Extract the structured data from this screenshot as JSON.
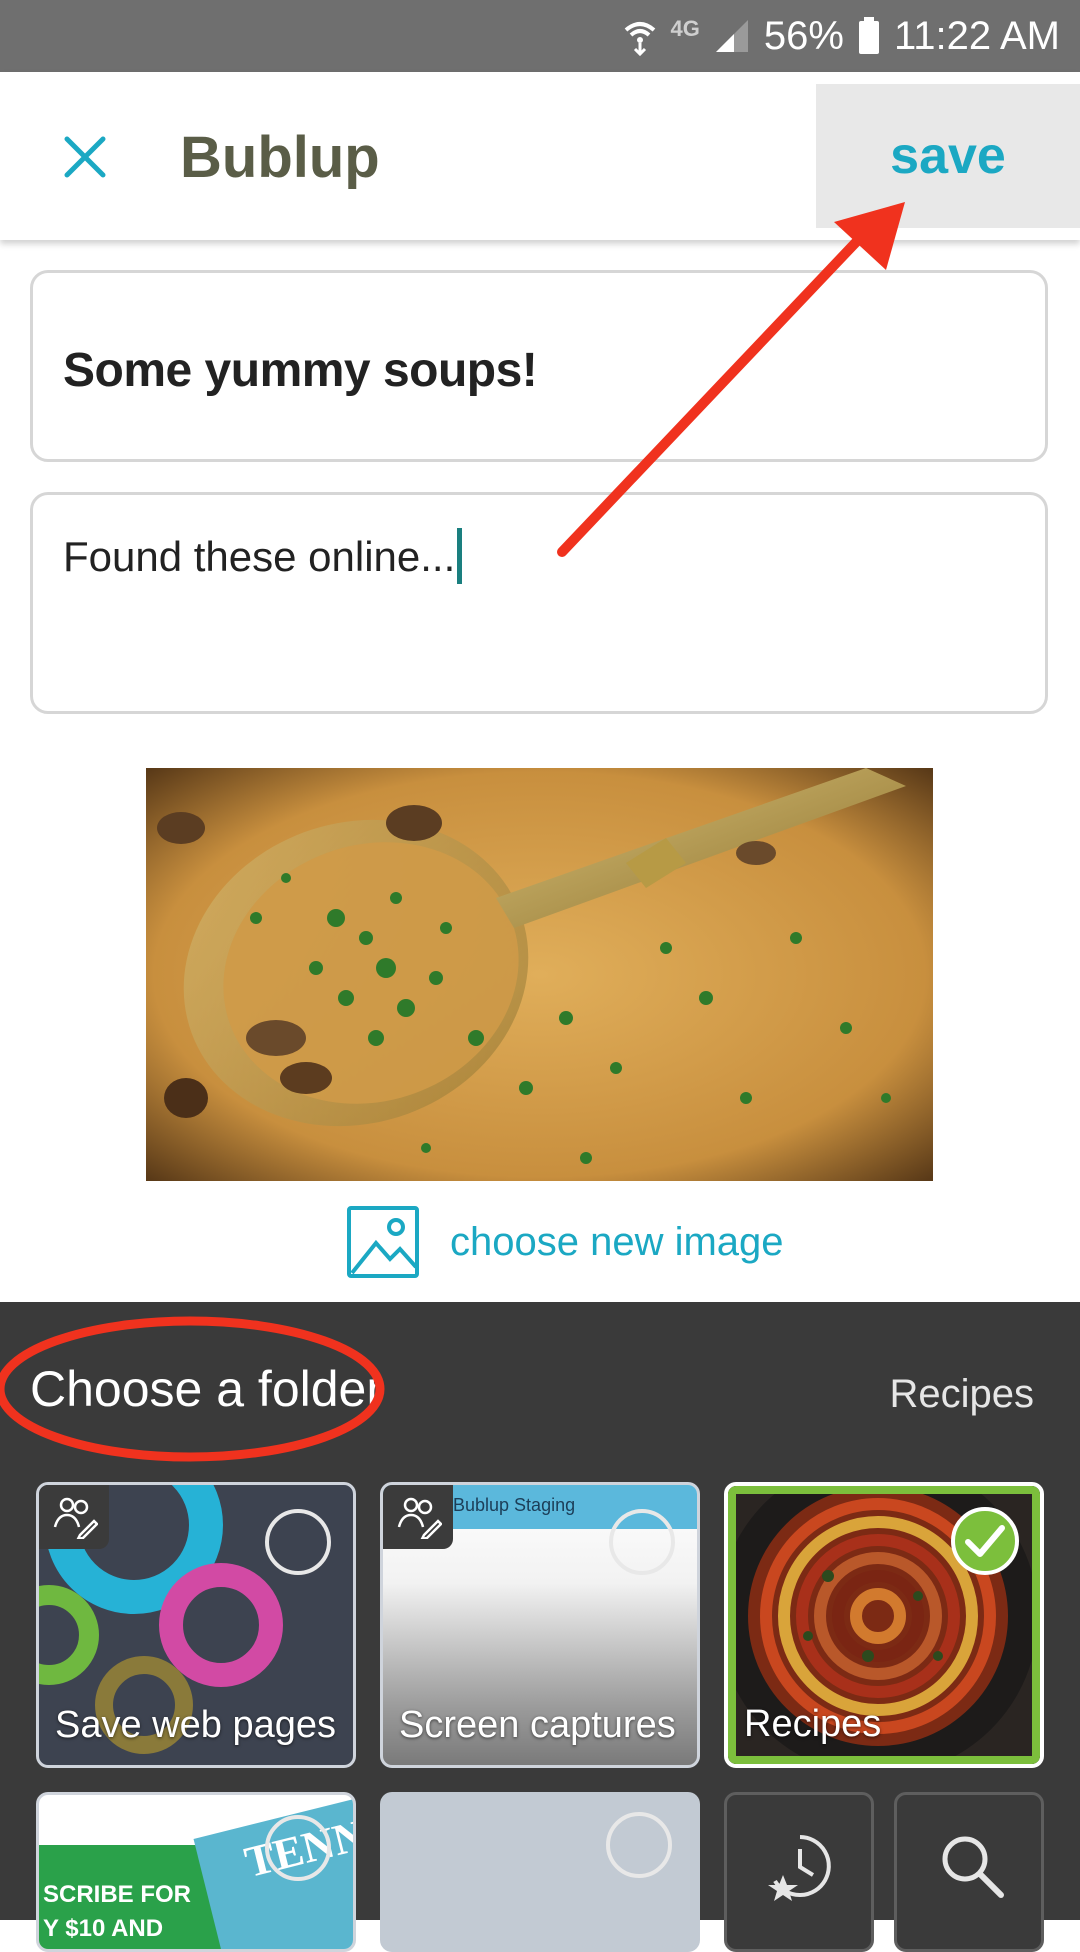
{
  "status_bar": {
    "network": "4G",
    "battery": "56%",
    "time": "11:22 AM"
  },
  "header": {
    "app_title": "Bublup",
    "save_label": "save"
  },
  "form": {
    "title_value": "Some yummy soups!",
    "description_value": "Found these online..."
  },
  "image": {
    "choose_label": "choose new image"
  },
  "folders": {
    "heading": "Choose a folder",
    "selected": "Recipes",
    "items": [
      {
        "label": "Save web pages",
        "shared": true,
        "selected": false
      },
      {
        "label": "Screen captures",
        "shared": true,
        "selected": false,
        "preview_text": "Bublup Staging"
      },
      {
        "label": "Recipes",
        "shared": false,
        "selected": true
      },
      {
        "label": "",
        "preview_text_1": "SCRIBE FOR",
        "preview_text_2": "Y $10 AND",
        "preview_text_3": "TENN",
        "selected": false
      },
      {
        "label": "",
        "selected": false
      }
    ],
    "actions": [
      {
        "icon": "recent-star-icon"
      },
      {
        "icon": "search-icon"
      }
    ]
  },
  "colors": {
    "accent": "#1ba8c3",
    "title": "#5a5d47",
    "panel": "#3a3a3a",
    "selected_border": "#7cbf3c",
    "annotation": "#f0321e"
  }
}
